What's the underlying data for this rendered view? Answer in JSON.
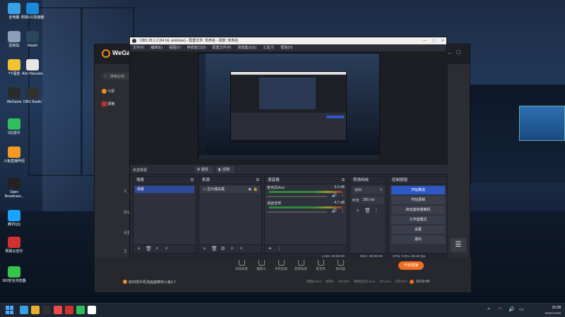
{
  "desktop": {
    "icons": [
      {
        "label": "此电脑",
        "color": "#3aa0e6"
      },
      {
        "label": "网易UU加速器",
        "color": "#1e88d8"
      },
      {
        "label": "回收站",
        "color": "#8aa0b8"
      },
      {
        "label": "Steam",
        "color": "#2a475e"
      },
      {
        "label": "YY语音",
        "color": "#f1c232"
      },
      {
        "label": "Aim Hercules",
        "color": "#e6e6e6"
      },
      {
        "label": "WeGame",
        "color": "#2b2b2b"
      },
      {
        "label": "OBS Studio",
        "color": "#303030"
      },
      {
        "label": "QQ音乐",
        "color": "#2fbf5a"
      },
      {
        "label": "斗鱼直播伴侣",
        "color": "#f59a23"
      },
      {
        "label": "Open Broadcast...",
        "color": "#222"
      },
      {
        "label": "腾讯QQ",
        "color": "#1aa3ff"
      },
      {
        "label": "网易云音乐",
        "color": "#d0302f"
      },
      {
        "label": "360安全浏览器",
        "color": "#36c44a"
      }
    ]
  },
  "wegame": {
    "logo": "WeGam",
    "search_placeholder": "搜索应用",
    "side_items": [
      "与那",
      "梁格"
    ],
    "left_labels": [
      "工",
      "协议",
      "设置",
      "主"
    ],
    "tip_text": "如何把手机流画面推到斗鱼6.7",
    "bottom_stats": [
      "网络0.0ms",
      "帧率0",
      "GPU0%",
      "网络延迟0.0ms",
      "CPU4%",
      "内存42%"
    ],
    "timer": "00:02:45",
    "toolbar": [
      "添加场景",
      "摄像头",
      "手机投屏",
      "游戏投屏",
      "麦克风",
      "扬声器"
    ],
    "start_label": "开启直播"
  },
  "obs": {
    "title": "OBS 28.1.2 (64 bit, windows) - 配置文件: 未命名 - 场景: 未命名",
    "menu": [
      "文件(F)",
      "编辑(E)",
      "视图(V)",
      "停靠窗口(D)",
      "配置文件(P)",
      "场景集合(S)",
      "工具(T)",
      "帮助(H)"
    ],
    "context": {
      "none_selected": "未选择源",
      "properties": "属性",
      "filters": "滤镜"
    },
    "docks": {
      "scenes": {
        "title": "场景",
        "items": [
          "场景"
        ]
      },
      "sources": {
        "title": "来源",
        "items": [
          "显示器采集"
        ]
      },
      "mixer": {
        "title": "混音器",
        "channels": [
          {
            "name": "麦克风/Aux",
            "db": "0.0 dB"
          },
          {
            "name": "桌面音频",
            "db": "-4.7 dB"
          }
        ]
      },
      "transitions": {
        "title": "转场特效",
        "type": "淡出",
        "duration_label": "时长",
        "duration": "300 ms"
      },
      "controls": {
        "title": "控制按钮",
        "buttons": [
          "开始推流",
          "开始录制",
          "启动虚拟摄像机",
          "工作室模式",
          "设置",
          "退出"
        ]
      }
    },
    "status": {
      "live": "LIVE: 00:00:00",
      "rec": "REC: 00:00:00",
      "cpu": "CPU: 0.9%, 60.00 fps"
    }
  },
  "taskbar": {
    "time": "15:28",
    "date": "2022/12/20",
    "colors": [
      "#3aa0e6",
      "#e8b030",
      "#303030",
      "#e84a4a",
      "#d0302f",
      "#2fbf5a",
      "#fff"
    ]
  }
}
